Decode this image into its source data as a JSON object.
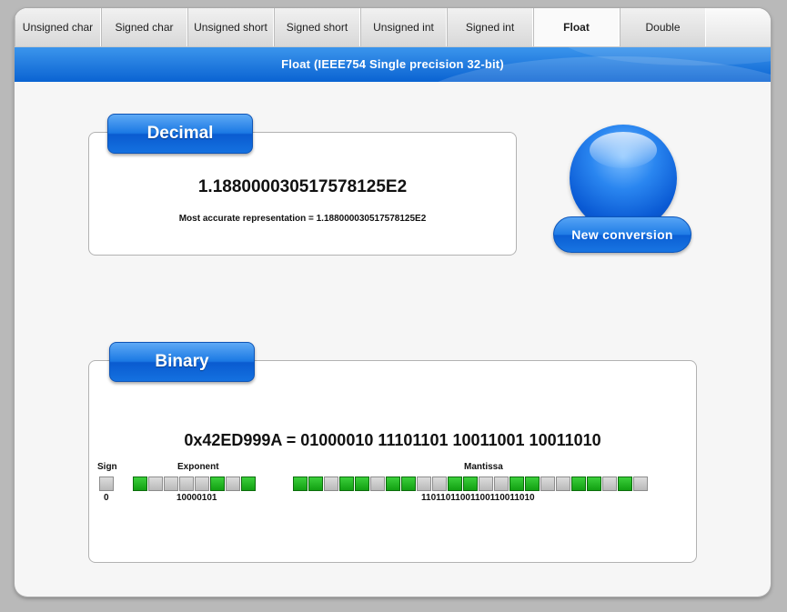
{
  "tabs": [
    {
      "label": "Unsigned char",
      "active": false
    },
    {
      "label": "Signed char",
      "active": false
    },
    {
      "label": "Unsigned short",
      "active": false
    },
    {
      "label": "Signed short",
      "active": false
    },
    {
      "label": "Unsigned int",
      "active": false
    },
    {
      "label": "Signed int",
      "active": false
    },
    {
      "label": "Float",
      "active": true
    },
    {
      "label": "Double",
      "active": false
    }
  ],
  "banner": {
    "title": "Float (IEEE754 Single precision 32-bit)"
  },
  "decimal": {
    "heading": "Decimal",
    "value": "1.188000030517578125E2",
    "accurate": "Most accurate representation = 1.188000030517578125E2"
  },
  "new_conversion": {
    "label": "New conversion"
  },
  "binary": {
    "heading": "Binary",
    "hex_line": "0x42ED999A = 01000010 11101101 10011001 10011010",
    "sign": {
      "label": "Sign",
      "value": "0",
      "bits": "0"
    },
    "exponent": {
      "label": "Exponent",
      "value": "10000101",
      "bits": "10000101"
    },
    "mantissa": {
      "label": "Mantissa",
      "value": "11011011001100110011010",
      "bits": "11011011001100110011010"
    }
  },
  "colors": {
    "bit_on": "#1fb51f",
    "bit_off": "#c8c8c8",
    "accent_blue": "#1471e0"
  }
}
